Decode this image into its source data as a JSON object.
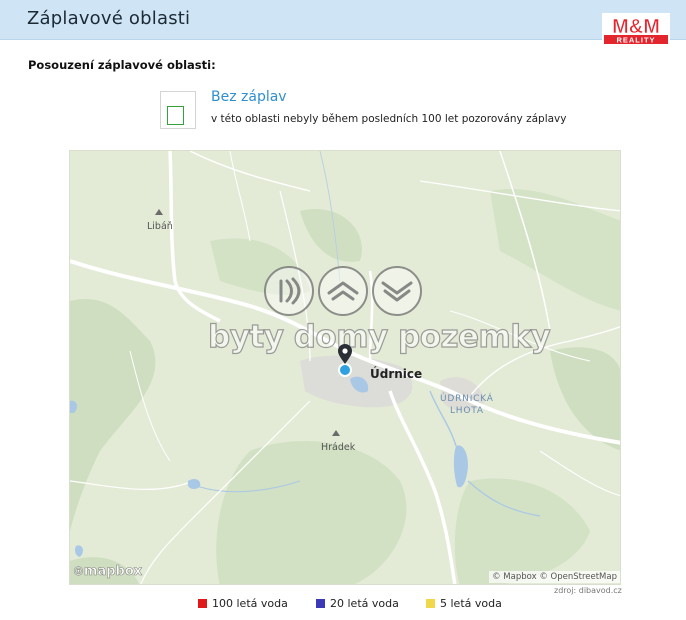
{
  "header": {
    "title": "Záplavové oblasti",
    "logo_text_top": "M&M",
    "logo_text_bottom": "REALITY"
  },
  "section": {
    "title": "Posouzení záplavové oblasti:"
  },
  "status": {
    "title": "Bez záplav",
    "description": "v této oblasti nebyly během posledních 100 let pozorovány záplavy",
    "color": "#35a13a"
  },
  "map": {
    "places": {
      "liban": "Libáň",
      "udrnice": "Údrnice",
      "hradek": "Hrádek",
      "district_line1": "ÚDRNICKÁ",
      "district_line2": "LHOTA"
    },
    "watermark": "byty domy pozemky",
    "watermark_icons": [
      "sound-waves-icon",
      "roof-icon",
      "layers-icon"
    ],
    "mapbox_logo": "mapbox",
    "attribution": "© Mapbox © OpenStreetMap",
    "marker_icon": "map-pin-icon"
  },
  "source": "zdroj: dibavod.cz",
  "legend": [
    {
      "label": "100 letá voda",
      "color": "#e01818"
    },
    {
      "label": "20 letá voda",
      "color": "#3a3ab8"
    },
    {
      "label": "5 letá voda",
      "color": "#f0d84a"
    }
  ]
}
